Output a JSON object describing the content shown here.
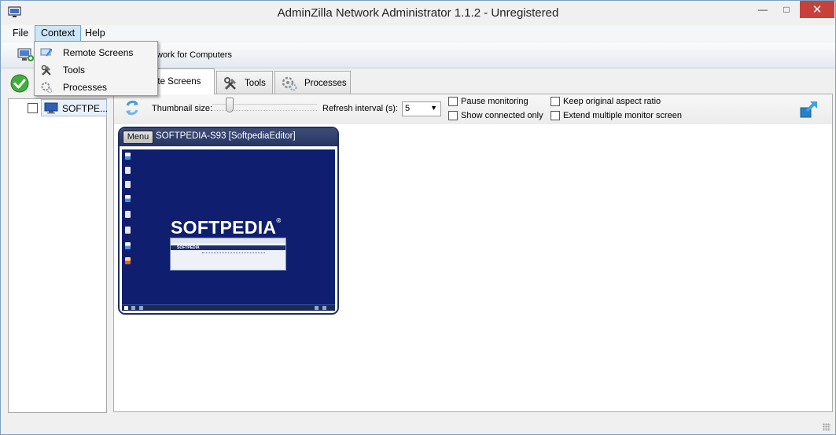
{
  "window": {
    "title": "AdminZilla Network Administrator 1.1.2 - Unregistered",
    "app_icon": "monitor-icon",
    "controls": {
      "minimize": "—",
      "maximize": "□",
      "close": "✕"
    }
  },
  "menubar": {
    "items": [
      {
        "label": "File"
      },
      {
        "label": "Context",
        "open": true
      },
      {
        "label": "Help"
      }
    ]
  },
  "context_menu": {
    "items": [
      {
        "label": "Remote Screens",
        "icon": "remote-screens-icon"
      },
      {
        "label": "Tools",
        "icon": "tools-icon"
      },
      {
        "label": "Processes",
        "icon": "processes-icon"
      }
    ]
  },
  "toolbar": {
    "scan_label": "work for Computers",
    "scan_icon": "network-scan-icon"
  },
  "tree": {
    "nodes": [
      {
        "label": "SOFTPE...",
        "checked": false,
        "icon": "computer-icon"
      }
    ]
  },
  "tabs": [
    {
      "label": "ote Screens",
      "icon": "remote-screens-icon",
      "active": true
    },
    {
      "label": "Tools",
      "icon": "tools-icon",
      "active": false
    },
    {
      "label": "Processes",
      "icon": "processes-icon",
      "active": false
    }
  ],
  "controls": {
    "thumbnail_label": "Thumbnail size:",
    "refresh_label": "Refresh interval (s):",
    "refresh_value": "5",
    "checkboxes": {
      "pause": {
        "label": "Pause monitoring",
        "checked": false
      },
      "connected": {
        "label": "Show connected only",
        "checked": false
      },
      "aspect": {
        "label": "Keep original aspect ratio",
        "checked": false
      },
      "extend": {
        "label": "Extend multiple monitor screen",
        "checked": false
      }
    }
  },
  "thumbnail": {
    "menu_label": "Menu",
    "title": "SOFTPEDIA-S93 [SoftpediaEditor]",
    "screen_logo": "SOFTPEDIA",
    "screen_logo_mark": "®",
    "mini_window_text": "SOFTPEDIA"
  },
  "colors": {
    "accent": "#263560",
    "desktop": "#0f1e6e",
    "close_button": "#c7413b",
    "menu_highlight": "#cde6f7"
  }
}
